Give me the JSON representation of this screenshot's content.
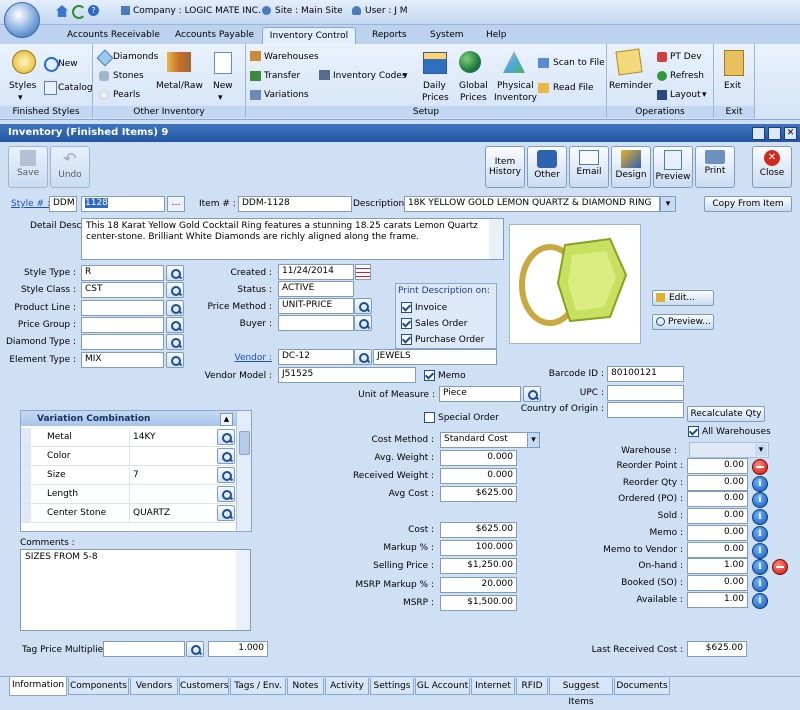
{
  "titlebar": {
    "company": "Company : LOGIC MATE INC.",
    "site": "Site : Main Site",
    "user": "User : J M"
  },
  "menu_tabs": [
    "Accounts Receivable",
    "Accounts Payable",
    "Inventory Control",
    "Reports",
    "System",
    "Help"
  ],
  "ribbon": {
    "finished_styles": {
      "label": "Finished Styles",
      "styles": "Styles",
      "new": "New",
      "catalog": "Catalog"
    },
    "other_inventory": {
      "label": "Other Inventory",
      "diamonds": "Diamonds",
      "stones": "Stones",
      "pearls": "Pearls",
      "metal_raw": "Metal/Raw",
      "new": "New"
    },
    "setup": {
      "label": "Setup",
      "warehouses": "Warehouses",
      "transfer": "Transfer",
      "variations": "Variations",
      "inventory_codes": "Inventory Codes"
    },
    "prices": {
      "daily": [
        "Daily",
        "Prices"
      ],
      "global": [
        "Global",
        "Prices"
      ],
      "physical": [
        "Physical",
        "Inventory"
      ],
      "scan_to_file": "Scan to File",
      "read_file": "Read File"
    },
    "operations": {
      "label": "Operations",
      "reminder": "Reminder",
      "pt_dev": "PT Dev",
      "refresh": "Refresh",
      "layout": "Layout"
    },
    "exit": {
      "label": "Exit",
      "exit": "Exit"
    }
  },
  "window": {
    "title": "Inventory (Finished Items) 9"
  },
  "toolbar": {
    "save": "Save",
    "undo": "Undo",
    "item_history": [
      "Item",
      "History"
    ],
    "other": "Other",
    "email": "Email",
    "design": "Design",
    "preview": "Preview",
    "print": "Print",
    "close": "Close"
  },
  "header": {
    "style_label": "Style # :",
    "style_prefix": "DDM",
    "style_value": "1128",
    "item_label": "Item # :",
    "item_value": "DDM-1128",
    "desc_label": "Description :",
    "desc_value": "18K YELLOW GOLD LEMON QUARTZ & DIAMOND RING",
    "copy_btn": "Copy From Item"
  },
  "detail": {
    "label": "Detail Desc :",
    "text": "This 18 Karat Yellow Gold Cocktail Ring features a stunning 18.25 carats Lemon Quartz center-stone. Brilliant White Diamonds are richly aligned along the frame."
  },
  "left_fields": [
    {
      "label": "Style Type :",
      "value": "R"
    },
    {
      "label": "Style Class :",
      "value": "CST"
    },
    {
      "label": "Product Line :",
      "value": ""
    },
    {
      "label": "Price Group :",
      "value": ""
    },
    {
      "label": "Diamond Type :",
      "value": ""
    },
    {
      "label": "Element Type :",
      "value": "MIX"
    }
  ],
  "mid": {
    "created_label": "Created :",
    "created": "11/24/2014",
    "status_label": "Status :",
    "status": "ACTIVE",
    "price_method_label": "Price Method :",
    "price_method": "UNIT-PRICE",
    "buyer_label": "Buyer :",
    "buyer": "",
    "vendor_label": "Vendor :",
    "vendor": "DC-12",
    "vendor_name": "JEWELS",
    "vendor_model_label": "Vendor Model :",
    "vendor_model": "J51525",
    "memo": "Memo",
    "uom_label": "Unit of Measure :",
    "uom": "Piece",
    "special_order": "Special Order"
  },
  "print_desc": {
    "title": "Print Description on:",
    "items": [
      "Invoice",
      "Sales Order",
      "Purchase Order"
    ]
  },
  "image_buttons": {
    "edit": "Edit...",
    "preview": "Preview..."
  },
  "right_fields": {
    "barcode_label": "Barcode ID :",
    "barcode": "80100121",
    "upc_label": "UPC :",
    "upc": "",
    "coo_label": "Country of Origin :",
    "coo": "",
    "recalc": "Recalculate Qty",
    "all_wh": "All Warehouses"
  },
  "variation": {
    "title": "Variation Combination",
    "rows": [
      {
        "name": "Metal",
        "value": "14KY"
      },
      {
        "name": "Color",
        "value": ""
      },
      {
        "name": "Size",
        "value": "7"
      },
      {
        "name": "Length",
        "value": ""
      },
      {
        "name": "Center Stone",
        "value": "QUARTZ"
      }
    ]
  },
  "comments": {
    "label": "Comments :",
    "text": "SIZES FROM 5-8"
  },
  "tag": {
    "label": "Tag Price Multiplier :",
    "value": "",
    "multiplier": "1.000"
  },
  "cost": {
    "cost_method_label": "Cost Method :",
    "cost_method": "Standard Cost",
    "rows1": [
      {
        "label": "Avg. Weight :",
        "value": "0.000"
      },
      {
        "label": "Received Weight :",
        "value": "0.000"
      },
      {
        "label": "Avg Cost :",
        "value": "$625.00"
      }
    ],
    "rows2": [
      {
        "label": "Cost :",
        "value": "$625.00"
      },
      {
        "label": "Markup % :",
        "value": "100.000"
      },
      {
        "label": "Selling Price :",
        "value": "$1,250.00"
      },
      {
        "label": "MSRP Markup % :",
        "value": "20.000"
      },
      {
        "label": "MSRP :",
        "value": "$1,500.00"
      }
    ]
  },
  "stock": {
    "warehouse_label": "Warehouse :",
    "rows": [
      {
        "label": "Reorder Point :",
        "value": "0.00"
      },
      {
        "label": "Reorder Qty :",
        "value": "0.00"
      },
      {
        "label": "Ordered (PO) :",
        "value": "0.00"
      },
      {
        "label": "Sold :",
        "value": "0.00"
      },
      {
        "label": "Memo :",
        "value": "0.00"
      },
      {
        "label": "Memo to Vendor :",
        "value": "0.00"
      },
      {
        "label": "On-hand :",
        "value": "1.00"
      },
      {
        "label": "Booked (SO) :",
        "value": "0.00"
      },
      {
        "label": "Available :",
        "value": "1.00"
      }
    ]
  },
  "last_cost": {
    "label": "Last  Received Cost :",
    "value": "$625.00"
  },
  "bottom_tabs": [
    "Information",
    "Components",
    "Vendors",
    "Customers",
    "Tags / Env.",
    "Notes",
    "Activity",
    "Settings",
    "GL Account",
    "Internet",
    "RFID",
    "Suggest Items",
    "Documents"
  ],
  "colors": {
    "window_bg": "#cfe0f5",
    "title_bar": "#2d5ea8",
    "accent": "#1c4f8e"
  }
}
